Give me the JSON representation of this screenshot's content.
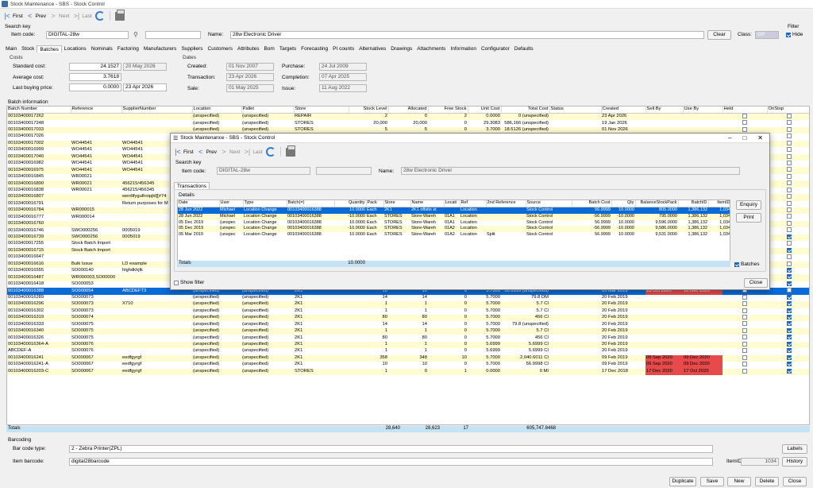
{
  "window": {
    "title": "Stock Maintenance - SBS - Stock Control"
  },
  "toolbar": {
    "first": "First",
    "prev": "Prev",
    "next": "Next",
    "last": "Last"
  },
  "search": {
    "section": "Search key",
    "item_code_label": "Item code:",
    "item_code": "DIGITAL-28w",
    "name_label": "Name:",
    "name": "28w Electronic Driver",
    "clear": "Clear",
    "class_label": "Class:",
    "class_value": "GP"
  },
  "filter": {
    "label": "Filter",
    "hide": "Hide"
  },
  "tabs": [
    "Main",
    "Stock",
    "Batches",
    "Locations",
    "Nominals",
    "Factoring",
    "Manufacturers",
    "Suppliers",
    "Customers",
    "Attributes",
    "Bom",
    "Targets",
    "Forecasting",
    "PI counts",
    "Alternatives",
    "Drawings",
    "Attachments",
    "Information",
    "Configurator",
    "Defaults"
  ],
  "costs": {
    "title": "Costs",
    "standard_label": "Standard cost:",
    "standard": "24.1527",
    "standard_date": "20 May 2026",
    "average_label": "Average cost:",
    "average": "3.7618",
    "last_label": "Last buying price:",
    "last": "0.0000",
    "last_date": "23 Apr 2026"
  },
  "dates": {
    "title": "Dates",
    "created_label": "Created:",
    "created": "01 Nov 2007",
    "transaction_label": "Transaction:",
    "transaction": "23 Apr 2026",
    "sale_label": "Sale:",
    "sale": "01 May 2025",
    "purchase_label": "Purchase:",
    "purchase": "24 Jul 2009",
    "completion_label": "Completion:",
    "completion": "07 Apr 2025",
    "issue_label": "Issue:",
    "issue": "11 Aug 2022"
  },
  "batch": {
    "title": "Batch information",
    "columns": [
      "Batch Number",
      "Reference",
      "SupplierNumber",
      "Location",
      "Pallet",
      "Store",
      "Stock Level",
      "Allocated",
      "Free Stock",
      "Unit Cost",
      "Total Cost",
      "Status",
      "Created",
      "Sell By",
      "Use By",
      "Held",
      "OnStop"
    ],
    "rows": [
      [
        "00103400017262",
        "",
        "",
        "(unspecified)",
        "(unspecified)",
        "REPAIR",
        "2",
        "0",
        "2",
        "0.0000",
        "0 (unspecified)",
        "",
        "23 Apr 2026",
        "",
        "",
        "",
        ""
      ],
      [
        "00103400017248",
        "",
        "",
        "(unspecified)",
        "(unspecified)",
        "STORES",
        "20,000",
        "20,000",
        "0",
        "29.3083",
        "586,166 (unspecified)",
        "",
        "19 Jan 2026",
        "",
        "",
        "",
        ""
      ],
      [
        "00103400017033",
        "",
        "",
        "(unspecified)",
        "(unspecified)",
        "STORES",
        "5",
        "5",
        "0",
        "3.7000",
        "18.5126 (unspecified)",
        "",
        "01 Nov 2026",
        "",
        "",
        "",
        ""
      ],
      [
        "00103400017026",
        "",
        "",
        "",
        "",
        "",
        "",
        "",
        "",
        "",
        "",
        "",
        "",
        "",
        "",
        "",
        ""
      ],
      [
        "00103400017002",
        "WO44541",
        "WO44541",
        "",
        "",
        "",
        "",
        "",
        "",
        "",
        "",
        "",
        "",
        "",
        "",
        "",
        ""
      ],
      [
        "00103400016999",
        "WO44541",
        "WO44541",
        "",
        "",
        "",
        "",
        "",
        "",
        "",
        "",
        "",
        "",
        "",
        "",
        "",
        ""
      ],
      [
        "00103400017040",
        "WO44541",
        "WO44541",
        "",
        "",
        "",
        "",
        "",
        "",
        "",
        "",
        "",
        "",
        "",
        "",
        "",
        ""
      ],
      [
        "00103400016982",
        "WO44541",
        "WO44541",
        "",
        "",
        "",
        "",
        "",
        "",
        "",
        "",
        "",
        "",
        "",
        "",
        "",
        ""
      ],
      [
        "00103400016975",
        "WO44541",
        "WO44541",
        "",
        "",
        "",
        "",
        "",
        "",
        "",
        "",
        "",
        "",
        "",
        "",
        "",
        ""
      ],
      [
        "00103400016845",
        "WR00021",
        "",
        "",
        "",
        "",
        "",
        "",
        "",
        "",
        "",
        "",
        "",
        "",
        "",
        "",
        ""
      ],
      [
        "00103400016890",
        "WR00021",
        "456215/456345",
        "",
        "",
        "",
        "",
        "",
        "",
        "",
        "",
        "",
        "",
        "",
        "",
        "",
        ""
      ],
      [
        "00103400016838",
        "WR00021",
        "456215/456345",
        "",
        "",
        "",
        "",
        "",
        "",
        "",
        "",
        "",
        "",
        "",
        "",
        "",
        ""
      ],
      [
        "00103400016807",
        "",
        "werdifygulhoipjkl[[#74",
        "",
        "",
        "",
        "",
        "",
        "",
        "",
        "",
        "",
        "",
        "",
        "",
        "",
        ""
      ],
      [
        "00103400016791",
        "",
        "Return purposes for M",
        "",
        "",
        "",
        "",
        "",
        "",
        "",
        "",
        "",
        "",
        "",
        "",
        "",
        ""
      ],
      [
        "00103400016784",
        "WR000015",
        "",
        "",
        "",
        "",
        "",
        "",
        "",
        "",
        "",
        "",
        "",
        "",
        "",
        "",
        ""
      ],
      [
        "00103400016777",
        "WR000014",
        "",
        "",
        "",
        "",
        "",
        "",
        "",
        "",
        "",
        "",
        "",
        "",
        "",
        "",
        ""
      ],
      [
        "00103400016760",
        "",
        "",
        "",
        "",
        "",
        "",
        "",
        "",
        "",
        "",
        "",
        "",
        "",
        "",
        "",
        ""
      ],
      [
        "00103400016746",
        "SWO000256",
        "0005019",
        "",
        "",
        "",
        "",
        "",
        "",
        "",
        "",
        "",
        "",
        "",
        "",
        "",
        ""
      ],
      [
        "00103400016739",
        "SWO000256",
        "0005019",
        "",
        "",
        "",
        "",
        "",
        "",
        "",
        "",
        "",
        "",
        "",
        "",
        "",
        "on"
      ],
      [
        "00103400017255",
        "Stock Batch Import",
        "",
        "",
        "",
        "",
        "",
        "",
        "",
        "",
        "",
        "",
        "",
        "",
        "",
        "",
        ""
      ],
      [
        "00103400016715",
        "Stock Batch Import",
        "",
        "",
        "",
        "",
        "",
        "",
        "",
        "",
        "",
        "",
        "",
        "",
        "",
        "",
        "on"
      ],
      [
        "00103400016647",
        "",
        "",
        "",
        "",
        "",
        "",
        "",
        "",
        "",
        "",
        "",
        "",
        "",
        "",
        "",
        ""
      ],
      [
        "00103400016616",
        "Bulk Issue",
        "LD example",
        "",
        "",
        "",
        "",
        "",
        "",
        "",
        "",
        "",
        "",
        "",
        "",
        "",
        ""
      ],
      [
        "00103400016555",
        "SO000140",
        "hlghdkhjlk",
        "",
        "",
        "",
        "",
        "",
        "",
        "",
        "",
        "",
        "",
        "",
        "",
        "",
        "on"
      ],
      [
        "00103400016487",
        "WR000003,SO00000",
        "",
        "(unspecified)",
        "(unspecified)",
        "2K1",
        "1",
        "1",
        "0",
        "5.7000",
        "5.7 CI",
        "",
        "11 Jun 2019",
        "",
        "",
        "",
        "on"
      ],
      [
        "00103400016418",
        "SO000053",
        "",
        "(unspecified)",
        "(unspecified)",
        "2K1",
        "1",
        "1",
        "1",
        "1.9000",
        "1.9 CI",
        "",
        "28 Mar 2019",
        "",
        "",
        "",
        "on"
      ],
      [
        "00103400016388",
        "SO000054",
        "ABCDEFT3",
        "(unspecified)",
        "(unspecified)",
        "2K1",
        "10",
        "10",
        "0",
        "5.7000",
        "56.9999 (unspecified)",
        "",
        "05 Mar 2019",
        "18 Oct 2020",
        "18 Dec 2020",
        "",
        ""
      ],
      [
        "00103400016289",
        "SO000073",
        "",
        "(unspecified)",
        "(unspecified)",
        "2K1",
        "14",
        "14",
        "0",
        "5.7000",
        "79.8 DM",
        "",
        "20 Feb 2019",
        "",
        "",
        "",
        "on"
      ],
      [
        "00103400016296",
        "SO000073",
        "X710",
        "(unspecified)",
        "(unspecified)",
        "2K1",
        "1",
        "1",
        "0",
        "5.7000",
        "5.7 CI",
        "",
        "20 Feb 2019",
        "",
        "",
        "",
        "on"
      ],
      [
        "00103400016302",
        "SO000073",
        "",
        "(unspecified)",
        "(unspecified)",
        "2K1",
        "1",
        "1",
        "0",
        "5.7000",
        "5.7 CI",
        "",
        "20 Feb 2019",
        "",
        "",
        "",
        "on"
      ],
      [
        "00103400016319",
        "SO000074",
        "",
        "(unspecified)",
        "(unspecified)",
        "2K1",
        "80",
        "80",
        "0",
        "5.7000",
        "456 CI",
        "",
        "20 Feb 2019",
        "",
        "",
        "",
        "on"
      ],
      [
        "00103400016333",
        "SO000075",
        "",
        "(unspecified)",
        "(unspecified)",
        "2K1",
        "14",
        "14",
        "0",
        "5.7000",
        "79.8 (unspecified)",
        "",
        "20 Feb 2019",
        "",
        "",
        "",
        "on"
      ],
      [
        "00103400016340",
        "SO000075",
        "",
        "(unspecified)",
        "(unspecified)",
        "2K1",
        "1",
        "1",
        "0",
        "5.7000",
        "5.7 CI",
        "",
        "20 Feb 2019",
        "",
        "",
        "",
        "on"
      ],
      [
        "00103400016326",
        "SO000075",
        "",
        "(unspecified)",
        "(unspecified)",
        "2K1",
        "80",
        "80",
        "0",
        "5.7000",
        "456 CI",
        "",
        "20 Feb 2019",
        "",
        "",
        "",
        "on"
      ],
      [
        "00103400016364-A",
        "SO000076",
        "",
        "(unspecified)",
        "(unspecified)",
        "2K1",
        "1",
        "1",
        "0",
        "5.6999",
        "5.6999 CI",
        "",
        "20 Feb 2019",
        "",
        "",
        "",
        "on"
      ],
      [
        "ABCDEF-A",
        "SO000076",
        "",
        "(unspecified)",
        "(unspecified)",
        "2K1",
        "1",
        "1",
        "0",
        "5.6999",
        "5.6999 CI",
        "",
        "20 Feb 2019",
        "",
        "",
        "",
        "on"
      ],
      [
        "00103400016241",
        "SO000067",
        "eedfgyrgf",
        "(unspecified)",
        "(unspecified)",
        "2K1",
        "358",
        "348",
        "10",
        "5.7000",
        "2,040.6011 CI",
        "",
        "09 Feb 2019",
        "09 Sep 2020",
        "09 Dec 2020",
        "",
        "on"
      ],
      [
        "00103400016241-A",
        "SO000067",
        "eedfgyrgf",
        "(unspecified)",
        "(unspecified)",
        "2K1",
        "10",
        "10",
        "0",
        "5.7000",
        "56.9998 CI",
        "",
        "09 Feb 2019",
        "09 Sep 2020",
        "09 Dec 2020",
        "",
        "on"
      ],
      [
        "00103400016203-C",
        "SO000067",
        "eedfgyrgf",
        "(unspecified)",
        "(unspecified)",
        "STORES",
        "1",
        "0",
        "1",
        "0.0000",
        "0 MI",
        "",
        "17 Dec 2018",
        "17 Dec 2020",
        "17 Oct 2020",
        "",
        "on"
      ]
    ],
    "totals": {
      "label": "Totals",
      "stock": "28,640",
      "allocated": "28,623",
      "free": "17",
      "cost": "605,747.8468"
    }
  },
  "barcoding": {
    "title": "Barcoding",
    "type_label": "Bar code type:",
    "type": "2 - Zebra Printer(ZPL)",
    "labels": "Labels",
    "item_label": "Item barcode:",
    "item": "digital28barcode",
    "itemid_label": "ItemID:",
    "itemid": "1034",
    "history": "History"
  },
  "footer": {
    "duplicate": "Duplicate",
    "save": "Save",
    "new": "New",
    "delete": "Delete",
    "close": "Close"
  },
  "dialog": {
    "title": "Stock Maintenance - SBS - Stock Control",
    "toolbar": {
      "first": "First",
      "prev": "Prev",
      "next": "Next",
      "last": "Last"
    },
    "search_key": "Search key",
    "item_code_label": "Item code:",
    "item_code": "DIGITAL-28w",
    "name_label": "Name:",
    "name": "28w Electronic Driver",
    "tab": "Transactions",
    "details": "Details",
    "columns": [
      "Date",
      "User",
      "Type",
      "Batch(=)",
      "Quantity",
      "Pack",
      "Store",
      "Name",
      "Locati",
      "Ref",
      "2nd Reference",
      "Source",
      "Batch Cost",
      "Qty",
      "BalanceStockPack",
      "BatchID",
      "ItemID"
    ],
    "rows": [
      [
        "28 Jun 2022",
        "Michael",
        "Location Change",
        "00103400016388",
        "10.0000",
        "Each",
        "2K1",
        "2K1 offsite st",
        "",
        "Location",
        "",
        "Stock Control",
        "56.9999",
        "10.0000",
        "805.0000",
        "1,386,132",
        "1,034"
      ],
      [
        "28 Jun 2022",
        "Michael",
        "Location Change",
        "00103400016388",
        "-10.0000",
        "Each",
        "STORES",
        "Store-Wareh",
        "01A1",
        "Location",
        "",
        "Stock Control",
        "-56.9999",
        "-10.0000",
        "795.0000",
        "1,386,132",
        "1,034"
      ],
      [
        "05 Dec 2019",
        "(unspec",
        "Location Change",
        "00103400016388",
        "10.0000",
        "Each",
        "STORES",
        "Store-Wareh",
        "01A1",
        "Location",
        "",
        "Stock Control",
        "56.9999",
        "10.0000",
        "9,596.0000",
        "1,386,132",
        "1,034"
      ],
      [
        "05 Dec 2019",
        "(unspec",
        "Location Change",
        "00103400016388",
        "-10.0000",
        "Each",
        "STORES",
        "Store-Wareh",
        "01A2",
        "Location",
        "",
        "Stock Control",
        "-56.9999",
        "-10.0000",
        "9,586.0000",
        "1,386,132",
        "1,034"
      ],
      [
        "05 Mar 2019",
        "(unspec",
        "Location Change",
        "00103400016388",
        "10.0000",
        "Each",
        "STORES",
        "Store-Wareh",
        "01A2",
        "Location",
        "Split",
        "Stock Control",
        "56.9999",
        "10.0000",
        "9,531.0000",
        "1,386,132",
        "1,034"
      ]
    ],
    "totals_label": "Totals",
    "totals_qty": "10.0000",
    "enquiry": "Enquiry",
    "print": "Print",
    "batches": "Batches",
    "show_filter": "Show filter",
    "close": "Close"
  }
}
